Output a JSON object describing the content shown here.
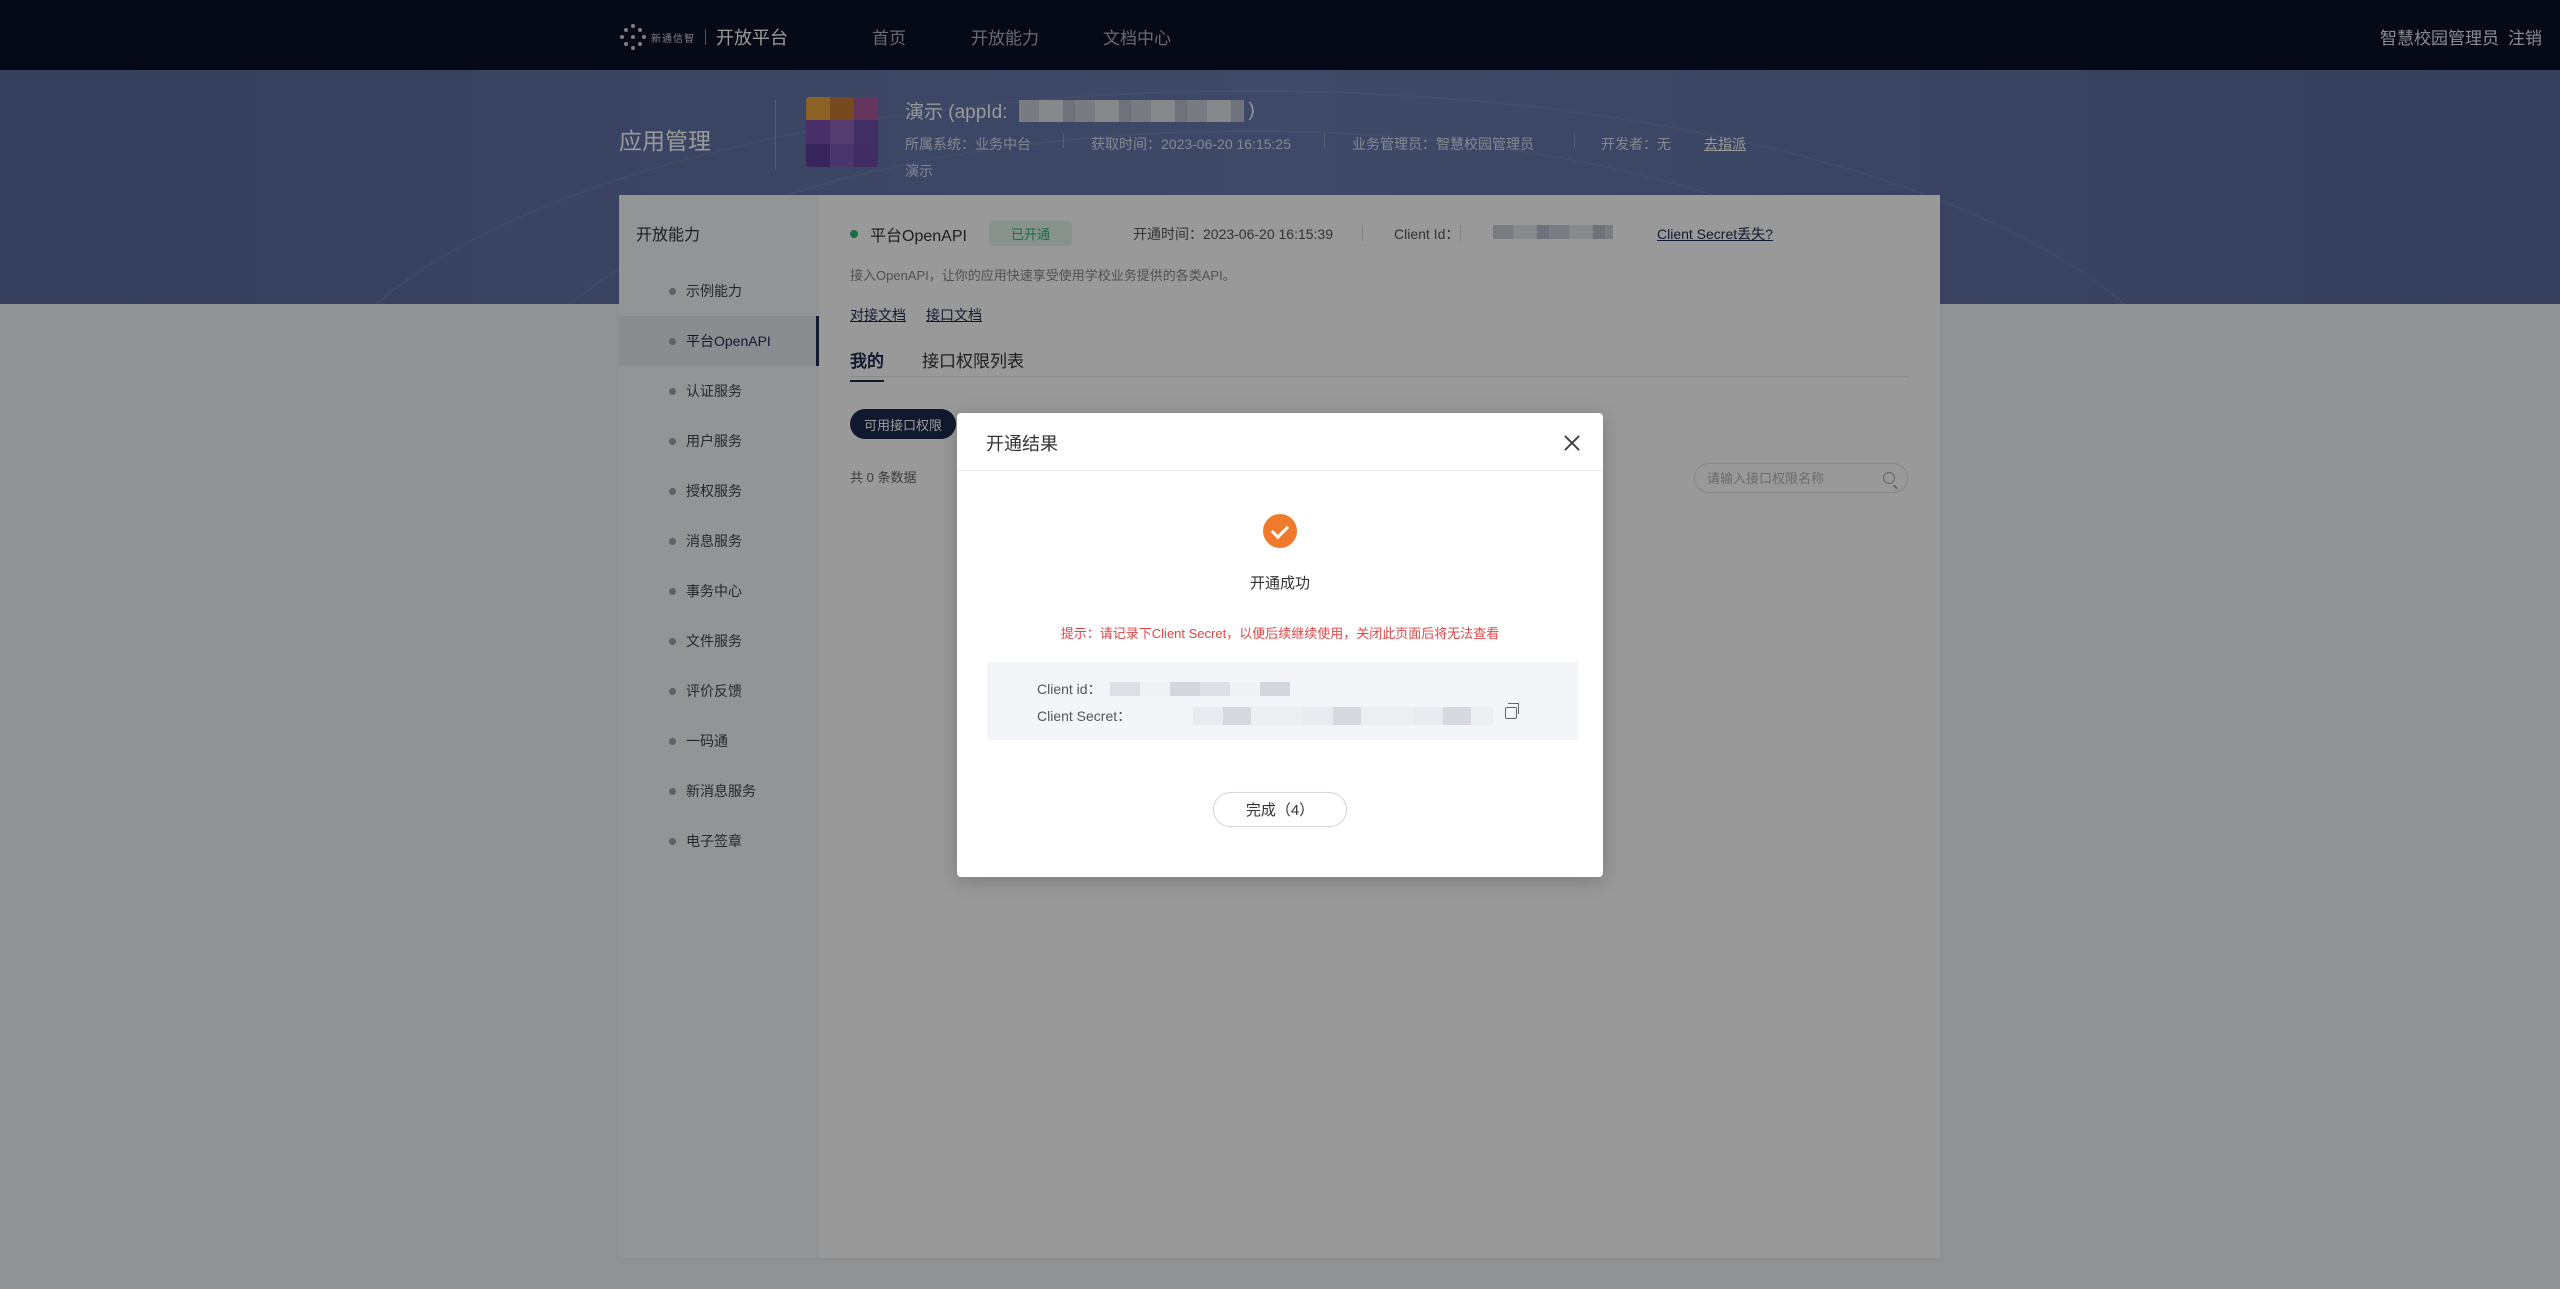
{
  "topbar": {
    "logo_small": "新通信智",
    "logo_name": "开放平台",
    "nav": [
      "首页",
      "开放能力",
      "文档中心"
    ],
    "user": "智慧校园管理员",
    "logout": "注销"
  },
  "banner": {
    "section_title": "应用管理",
    "app_name_prefix": "演示 (appId:",
    "app_name_suffix": ")",
    "system": "所属系统：业务中台",
    "created": "获取时间：2023-06-20 16:15:25",
    "manager": "业务管理员：智慧校园管理员",
    "developer": "开发者：无",
    "go_claim": "去指派",
    "desc": "演示",
    "icon_colors": [
      "#e8a23c",
      "#c77b34",
      "#a85a9c",
      "#7b4fb0",
      "#8e64b8",
      "#6c4fa8",
      "#5c3f9a",
      "#7a5ab6",
      "#6a4aa6"
    ]
  },
  "sidebar": {
    "title": "开放能力",
    "items": [
      "示例能力",
      "平台OpenAPI",
      "认证服务",
      "用户服务",
      "授权服务",
      "消息服务",
      "事务中心",
      "文件服务",
      "评价反馈",
      "一码通",
      "新消息服务",
      "电子签章"
    ],
    "active_index": 1
  },
  "content": {
    "api_name": "平台OpenAPI",
    "status": "已开通",
    "open_time": "开通时间：2023-06-20 16:15:39",
    "client_id_label": "Client Id：",
    "lost_link": "Client Secret丢失?",
    "desc": "接入OpenAPI，让你的应用快速享受使用学校业务提供的各类API。",
    "doc_links": [
      "对接文档",
      "接口文档"
    ],
    "tabs": [
      "我的",
      "接口权限列表"
    ],
    "perm_button": "可用接口权限",
    "total": "共 0 条数据",
    "search_placeholder": "请输入接口权限名称"
  },
  "modal": {
    "title": "开通结果",
    "success": "开通成功",
    "tip": "提示：请记录下Client Secret，以便后续继续使用，关闭此页面后将无法查看",
    "client_id_label": "Client id：",
    "client_secret_label": "Client Secret：",
    "done_button": "完成（4）"
  },
  "colors": {
    "topbar": "#0b1226",
    "banner": "#6879ad",
    "accent": "#1d2a4d",
    "success_orange": "#f07a2b",
    "tip_red": "#e64545",
    "open_green": "#2bb673"
  }
}
